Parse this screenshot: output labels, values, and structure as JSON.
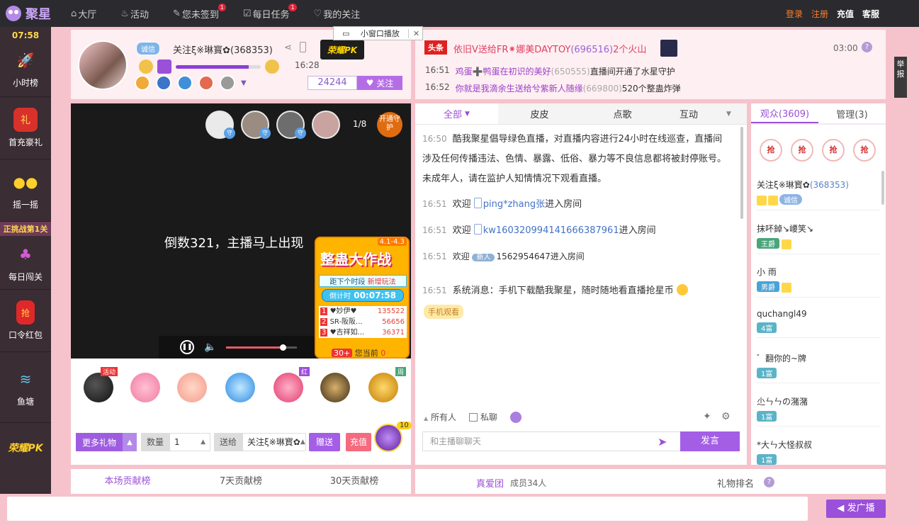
{
  "topbar": {
    "logo": "聚星",
    "nav": [
      {
        "label": "大厅",
        "icon": "home-icon",
        "badge": ""
      },
      {
        "label": "活动",
        "icon": "flame-icon",
        "badge": ""
      },
      {
        "label": "您未签到",
        "icon": "edit-icon",
        "badge": "1"
      },
      {
        "label": "每日任务",
        "icon": "task-icon",
        "badge": "1"
      },
      {
        "label": "我的关注",
        "icon": "heart-icon",
        "badge": ""
      }
    ],
    "login": "登录",
    "register": "注册",
    "recharge": "充值",
    "service": "客服"
  },
  "sidebar": {
    "time": "07:58",
    "items": [
      {
        "label": "小时榜",
        "icon": "rocket-icon",
        "color": "#3a2d33"
      },
      {
        "label": "首充豪礼",
        "icon": "gift-bag-icon",
        "color": "#3a2d33"
      },
      {
        "label": "摇一摇",
        "icon": "coin-icon",
        "color": "#3a2d33"
      },
      {
        "label": "每日闯关",
        "icon": "mushroom-icon",
        "color": "#3a2d33"
      },
      {
        "label": "口令红包",
        "icon": "red-packet-icon",
        "color": "#3a2d33"
      },
      {
        "label": "鱼塘",
        "icon": "fishpond-icon",
        "color": "#3a2d33"
      }
    ],
    "challenge": "正挑战第1关",
    "pk_logo": "荣耀PK"
  },
  "anchor": {
    "badge": "诚信",
    "name": "关注ξ※琳寳✿(368353)",
    "level_progress": 0.86,
    "level_time": "16:28",
    "fans": "24244",
    "follow": "关注",
    "pk_logo": "荣耀PK"
  },
  "popup": {
    "label": "小窗口播放",
    "close": "✕"
  },
  "news": {
    "tag": "头条",
    "text_a": "依旧V送给FR⁕娜美DAYTOY",
    "text_b": "(696516)",
    "text_c": "2个火山",
    "time": "03:00",
    "help": "?",
    "notices": [
      {
        "time": "16:51",
        "a": "鸡蛋➕鸭蛋在初识的美好",
        "b": "(650555)",
        "c": "直播间开通了水星守护"
      },
      {
        "time": "16:52",
        "a": "你就是我滴余生送给兮紫新人随缘",
        "b": "(669800)",
        "c": "520个整蛊炸弹"
      }
    ]
  },
  "video": {
    "countdown": "倒数321，主播马上出现",
    "page": "1/8",
    "open_guard": "开通守护",
    "guard_tag": "守",
    "seek_progress": 0.8
  },
  "war": {
    "date": "4.1-4.3",
    "title": "整蛊大作战",
    "sub": "距下个时段",
    "sub_tag": "新增玩法",
    "countdown_label": "倒计时",
    "countdown": "00:07:58",
    "ranks": [
      {
        "n": "1",
        "name": "♥妙伊♥",
        "v": "135522"
      },
      {
        "n": "2",
        "name": "SR-阪阪...",
        "v": "56656"
      },
      {
        "n": "3",
        "name": "♥吉祥如...",
        "v": "36371"
      }
    ],
    "foot_rank": "30+",
    "foot_text": "您当前",
    "foot_val": "0"
  },
  "gifts": {
    "tags": {
      "activity": "活动",
      "red": "红",
      "week": "周"
    },
    "more": "更多礼物",
    "qty_label": "数量",
    "qty": "1",
    "to_label": "送给",
    "to": "关注ξ※琳寳✿",
    "send": "赠送",
    "recharge": "充值",
    "feather_count": "10"
  },
  "chat": {
    "tabs": [
      "全部",
      "皮皮",
      "点歌",
      "互动"
    ],
    "system_time": "16:50",
    "system_text": "酷我聚星倡导绿色直播，对直播内容进行24小时在线巡查，直播间涉及任何传播违法、色情、暴露、低俗、暴力等不良信息都将被封停账号。未成年人，请在监护人知情情况下观看直播。",
    "welcome_word": "欢迎",
    "enter_text": "进入房间",
    "msgs": [
      {
        "time": "16:51",
        "user": "ping*zhang张"
      },
      {
        "time": "16:51",
        "user": "kw16032099414166638796​1"
      },
      {
        "time": "16:51",
        "user": "1562954647",
        "tag": "新人"
      }
    ],
    "sys_time": "16:51",
    "sys_msg": "系统消息：手机下载酷我聚星，随时随地看直播抢星币",
    "phone_watch": "手机观看",
    "all_people": "所有人",
    "private": "私聊",
    "placeholder": "和主播聊聊天",
    "speak": "发言"
  },
  "audience": {
    "tab_audience": "观众(3609)",
    "tab_admin": "管理(3)",
    "grab": "抢",
    "items": [
      {
        "name": "关注ξ※琳寳✿",
        "uid": "(368353)",
        "tags": [
          "诚信"
        ],
        "kind": "cx"
      },
      {
        "name": "抹吥鋽↘崾笑↘",
        "uid": "",
        "tags": [
          "王爵"
        ],
        "kind": "king"
      },
      {
        "name": "小 雨",
        "uid": "",
        "tags": [
          "男爵"
        ],
        "kind": "male"
      },
      {
        "name": "quchangl49",
        "uid": "",
        "tags": [
          "4富"
        ],
        "kind": "rich"
      },
      {
        "name": "゛翻你的~牌",
        "uid": "",
        "tags": [
          "1富"
        ],
        "kind": "rich"
      },
      {
        "name": "尐ㄣㄣの潴潴",
        "uid": "",
        "tags": [
          "1富"
        ],
        "kind": "rich"
      },
      {
        "name": "*大ㄣ大怪叔叔",
        "uid": "",
        "tags": [
          "1富"
        ],
        "kind": "rich"
      }
    ]
  },
  "ranks": {
    "tabs": [
      "本场贡献榜",
      "7天贡献榜",
      "30天贡献榜"
    ],
    "fan_group": "真爱团",
    "members": "成员34人",
    "gift_rank": "礼物排名",
    "help": "?"
  },
  "broadcast": {
    "button": "发广播"
  },
  "report": "举报"
}
